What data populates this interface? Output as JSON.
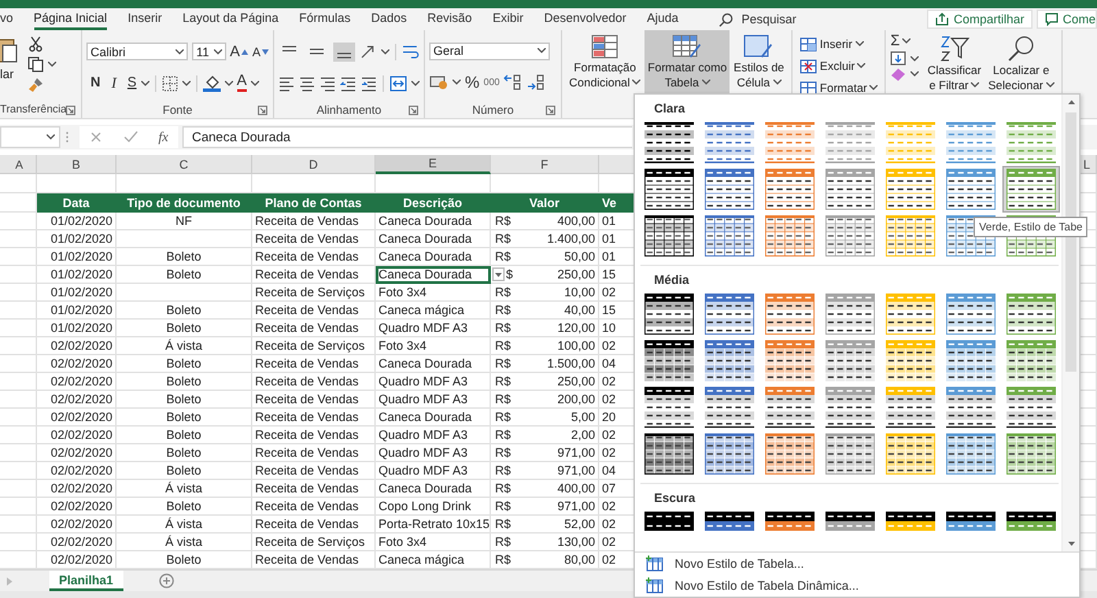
{
  "ribbon_tabs": [
    {
      "label": "vo",
      "selected": false
    },
    {
      "label": "Página Inicial",
      "selected": true
    },
    {
      "label": "Inserir",
      "selected": false
    },
    {
      "label": "Layout da Página",
      "selected": false
    },
    {
      "label": "Fórmulas",
      "selected": false
    },
    {
      "label": "Dados",
      "selected": false
    },
    {
      "label": "Revisão",
      "selected": false
    },
    {
      "label": "Exibir",
      "selected": false
    },
    {
      "label": "Desenvolvedor",
      "selected": false
    },
    {
      "label": "Ajuda",
      "selected": false
    }
  ],
  "search": {
    "placeholder": "Pesquisar"
  },
  "share_button": "Compartilhar",
  "comments_button": "Come",
  "clipboard": {
    "paste_label": "lar",
    "group_label": "Transferência"
  },
  "font": {
    "name": "Calibri",
    "size": "11",
    "grow_label": "A",
    "shrink_label": "A",
    "bold_label": "N",
    "italic_label": "I",
    "underline_label": "S",
    "color_label": "A",
    "group_label": "Fonte"
  },
  "alignment": {
    "vertical": [
      {
        "selected": false
      },
      {
        "selected": false
      },
      {
        "selected": true
      }
    ],
    "group_label": "Alinhamento"
  },
  "number": {
    "format": "Geral",
    "percent_label": "%",
    "thousands_label": "000",
    "group_label": "Número"
  },
  "styles_buttons": [
    {
      "kind": "conditional",
      "label_lines": [
        "Formatação",
        "Condicional"
      ],
      "selected": false
    },
    {
      "kind": "table",
      "label_lines": [
        "Formatar como",
        "Tabela"
      ],
      "selected": true
    },
    {
      "kind": "cell",
      "label_lines": [
        "Estilos de",
        "Célula"
      ],
      "selected": false
    }
  ],
  "cells_buttons": [
    {
      "kind": "insert",
      "label": "Inserir"
    },
    {
      "kind": "delete",
      "label": "Excluir"
    },
    {
      "kind": "format",
      "label": "Formatar"
    }
  ],
  "sum_label": "Σ",
  "editing_buttons": [
    {
      "kind": "sort",
      "label_lines": [
        "Classificar",
        "e Filtrar"
      ]
    },
    {
      "kind": "find",
      "label_lines": [
        "Localizar e",
        "Selecionar"
      ]
    }
  ],
  "formula_bar": {
    "fx_label": "fx",
    "value": "Caneca Dourada"
  },
  "columns": [
    "A",
    "B",
    "C",
    "D",
    "E",
    "F"
  ],
  "tail_column": "L",
  "table": {
    "headers": [
      "Data",
      "Tipo de documento",
      "Plano de Contas",
      "Descrição",
      "Valor",
      "Ve"
    ],
    "rows": [
      {
        "date": "01/02/2020",
        "doc": "NF",
        "plan": "Receita de Vendas",
        "desc": "Caneca Dourada",
        "currency": "R$",
        "value": "400,00",
        "next": "01",
        "selected": false
      },
      {
        "date": "01/02/2020",
        "plan": "Receita de Vendas",
        "desc": "Caneca Dourada",
        "currency": "R$",
        "value": "1.400,00",
        "next": "01",
        "selected": false
      },
      {
        "date": "01/02/2020",
        "doc": "Boleto",
        "plan": "Receita de Vendas",
        "desc": "Caneca Dourada",
        "currency": "R$",
        "value": "50,00",
        "next": "01",
        "selected": false
      },
      {
        "date": "01/02/2020",
        "doc": "Boleto",
        "plan": "Receita de Vendas",
        "desc": "Caneca Dourada",
        "currency": "$",
        "value": "250,00",
        "next": "15",
        "selected": true
      },
      {
        "date": "01/02/2020",
        "plan": "Receita de Serviços",
        "desc": "Foto 3x4",
        "currency": "R$",
        "value": "10,00",
        "next": "02",
        "selected": false
      },
      {
        "date": "01/02/2020",
        "doc": "Boleto",
        "plan": "Receita de Vendas",
        "desc": "Caneca mágica",
        "currency": "R$",
        "value": "40,00",
        "next": "15",
        "selected": false
      },
      {
        "date": "01/02/2020",
        "doc": "Boleto",
        "plan": "Receita de Vendas",
        "desc": "Quadro MDF A3",
        "currency": "R$",
        "value": "120,00",
        "next": "10",
        "selected": false
      },
      {
        "date": "02/02/2020",
        "doc": "Á vista",
        "plan": "Receita de Serviços",
        "desc": "Foto 3x4",
        "currency": "R$",
        "value": "100,00",
        "next": "02",
        "selected": false
      },
      {
        "date": "02/02/2020",
        "doc": "Boleto",
        "plan": "Receita de Vendas",
        "desc": "Caneca Dourada",
        "currency": "R$",
        "value": "1.500,00",
        "next": "04",
        "selected": false
      },
      {
        "date": "02/02/2020",
        "doc": "Boleto",
        "plan": "Receita de Vendas",
        "desc": "Quadro MDF A3",
        "currency": "R$",
        "value": "250,00",
        "next": "02",
        "selected": false
      },
      {
        "date": "02/02/2020",
        "doc": "Boleto",
        "plan": "Receita de Vendas",
        "desc": "Quadro MDF A3",
        "currency": "R$",
        "value": "200,00",
        "next": "02",
        "selected": false
      },
      {
        "date": "02/02/2020",
        "doc": "Boleto",
        "plan": "Receita de Vendas",
        "desc": "Caneca Dourada",
        "currency": "R$",
        "value": "5,00",
        "next": "20",
        "selected": false
      },
      {
        "date": "02/02/2020",
        "doc": "Boleto",
        "plan": "Receita de Vendas",
        "desc": "Quadro MDF A3",
        "currency": "R$",
        "value": "2,00",
        "next": "02",
        "selected": false
      },
      {
        "date": "02/02/2020",
        "doc": "Boleto",
        "plan": "Receita de Vendas",
        "desc": "Quadro MDF A3",
        "currency": "R$",
        "value": "971,00",
        "next": "02",
        "selected": false
      },
      {
        "date": "02/02/2020",
        "doc": "Boleto",
        "plan": "Receita de Vendas",
        "desc": "Quadro MDF A3",
        "currency": "R$",
        "value": "971,00",
        "next": "04",
        "selected": false
      },
      {
        "date": "02/02/2020",
        "doc": "Á vista",
        "plan": "Receita de Vendas",
        "desc": "Caneca Dourada",
        "currency": "R$",
        "value": "400,00",
        "next": "07",
        "selected": false
      },
      {
        "date": "02/02/2020",
        "doc": "Boleto",
        "plan": "Receita de Vendas",
        "desc": "Copo Long Drink",
        "currency": "R$",
        "value": "971,00",
        "next": "02",
        "selected": false
      },
      {
        "date": "02/02/2020",
        "doc": "Á vista",
        "plan": "Receita de Vendas",
        "desc": "Porta-Retrato 10x15",
        "currency": "R$",
        "value": "52,00",
        "next": "02",
        "selected": false
      },
      {
        "date": "02/02/2020",
        "doc": "Á vista",
        "plan": "Receita de Serviços",
        "desc": "Foto 3x4",
        "currency": "R$",
        "value": "130,00",
        "next": "02",
        "selected": false
      },
      {
        "date": "02/02/2020",
        "doc": "Boleto",
        "plan": "Receita de Vendas",
        "desc": "Caneca mágica",
        "currency": "R$",
        "value": "80,00",
        "next": "02",
        "selected": false
      }
    ]
  },
  "sheet_tabs": [
    {
      "label": "Planilha1",
      "selected": true
    }
  ],
  "gallery": {
    "sections": [
      {
        "title": "Clara",
        "rows": [
          {
            "kind": "light-banded",
            "items": [
              {
                "color": "#000000",
                "selected": false
              },
              {
                "color": "#4472c4",
                "selected": false
              },
              {
                "color": "#ed7d31",
                "selected": false
              },
              {
                "color": "#a5a5a5",
                "selected": false
              },
              {
                "color": "#ffc000",
                "selected": false
              },
              {
                "color": "#5b9bd5",
                "selected": false
              },
              {
                "color": "#70ad47",
                "selected": false
              }
            ]
          },
          {
            "kind": "header-lined",
            "items": [
              {
                "color": "#000000",
                "selected": false
              },
              {
                "color": "#4472c4",
                "selected": false
              },
              {
                "color": "#ed7d31",
                "selected": false
              },
              {
                "color": "#a5a5a5",
                "selected": false
              },
              {
                "color": "#ffc000",
                "selected": false
              },
              {
                "color": "#5b9bd5",
                "selected": false
              },
              {
                "color": "#70ad47",
                "selected": true
              }
            ]
          },
          {
            "kind": "grid-lined",
            "items": [
              {
                "color": "#000000",
                "selected": false
              },
              {
                "color": "#4472c4",
                "selected": false
              },
              {
                "color": "#ed7d31",
                "selected": false
              },
              {
                "color": "#a5a5a5",
                "selected": false
              },
              {
                "color": "#ffc000",
                "selected": false
              },
              {
                "color": "#5b9bd5",
                "selected": false
              },
              {
                "color": "#70ad47",
                "selected": false
              }
            ]
          }
        ]
      },
      {
        "title": "Média",
        "rows": [
          {
            "kind": "header-banded",
            "items": [
              {
                "color": "#000000",
                "selected": false
              },
              {
                "color": "#4472c4",
                "selected": false
              },
              {
                "color": "#ed7d31",
                "selected": false
              },
              {
                "color": "#a5a5a5",
                "selected": false
              },
              {
                "color": "#ffc000",
                "selected": false
              },
              {
                "color": "#5b9bd5",
                "selected": false
              },
              {
                "color": "#70ad47",
                "selected": false
              }
            ]
          },
          {
            "kind": "header-grid",
            "items": [
              {
                "color": "#000000",
                "selected": false
              },
              {
                "color": "#4472c4",
                "selected": false
              },
              {
                "color": "#ed7d31",
                "selected": false
              },
              {
                "color": "#a5a5a5",
                "selected": false
              },
              {
                "color": "#ffc000",
                "selected": false
              },
              {
                "color": "#5b9bd5",
                "selected": false
              },
              {
                "color": "#70ad47",
                "selected": false
              }
            ]
          },
          {
            "kind": "header-plain",
            "items": [
              {
                "color": "#000000",
                "selected": false
              },
              {
                "color": "#4472c4",
                "selected": false
              },
              {
                "color": "#ed7d31",
                "selected": false
              },
              {
                "color": "#a5a5a5",
                "selected": false
              },
              {
                "color": "#ffc000",
                "selected": false
              },
              {
                "color": "#5b9bd5",
                "selected": false
              },
              {
                "color": "#70ad47",
                "selected": false
              }
            ]
          },
          {
            "kind": "filled-grid",
            "items": [
              {
                "color": "#000000",
                "selected": false
              },
              {
                "color": "#4472c4",
                "selected": false
              },
              {
                "color": "#ed7d31",
                "selected": false
              },
              {
                "color": "#a5a5a5",
                "selected": false
              },
              {
                "color": "#ffc000",
                "selected": false
              },
              {
                "color": "#5b9bd5",
                "selected": false
              },
              {
                "color": "#70ad47",
                "selected": false
              }
            ]
          }
        ]
      },
      {
        "title": "Escura",
        "rows": [
          {
            "kind": "dark",
            "items": [
              {
                "color": "#000000",
                "selected": false
              },
              {
                "color": "#4472c4",
                "selected": false
              },
              {
                "color": "#ed7d31",
                "selected": false
              },
              {
                "color": "#a5a5a5",
                "selected": false
              },
              {
                "color": "#ffc000",
                "selected": false
              },
              {
                "color": "#5b9bd5",
                "selected": false
              },
              {
                "color": "#70ad47",
                "selected": false
              }
            ]
          }
        ]
      }
    ],
    "footer": [
      "Novo Estilo de Tabela...",
      "Novo Estilo de Tabela Dinâmica..."
    ]
  },
  "tooltip": "Verde, Estilo de Tabe"
}
